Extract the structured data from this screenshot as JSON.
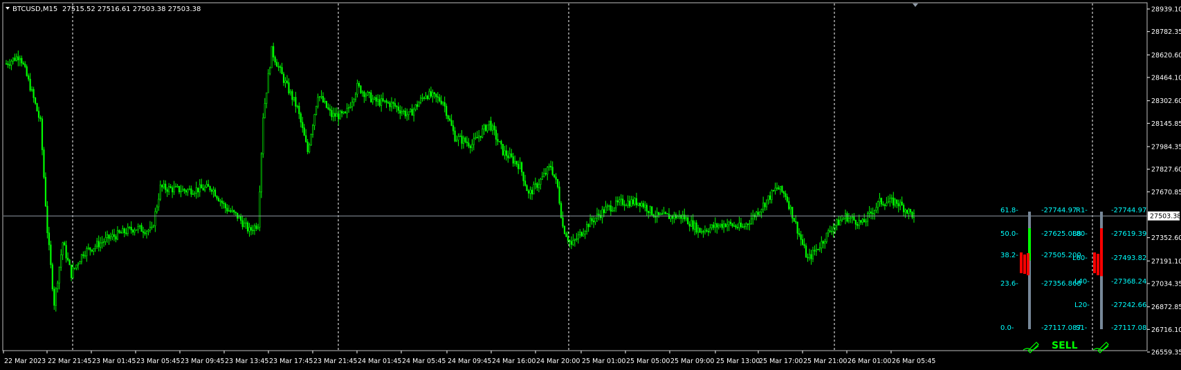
{
  "header": {
    "symbol": "BTCUSD,M15",
    "ohlc": "27515.52 27516.61 27503.38 27503.38"
  },
  "colors": {
    "background": "#000000",
    "candle": "#00ff00",
    "grid_separator": "#ffffff",
    "axis_text": "#ffffff",
    "price_line": "#8f9aa6",
    "fib_text": "#00ffff",
    "bar_up": "#00ff00",
    "bar_down": "#ff0000",
    "bar_track": "#778899",
    "sell_text": "#00ff00"
  },
  "price_axis": {
    "ticks": [
      "28939.10",
      "28782.35",
      "28620.60",
      "28464.10",
      "28302.60",
      "28145.85",
      "27984.35",
      "27827.60",
      "27670.85",
      "27352.60",
      "27191.10",
      "27034.35",
      "26872.85",
      "26716.10",
      "26559.35"
    ],
    "current_price": "27503.38",
    "range": [
      26559.35,
      28939.1
    ]
  },
  "time_axis": {
    "labels": [
      "22 Mar 2023",
      "22 Mar 21:45",
      "23 Mar 01:45",
      "23 Mar 05:45",
      "23 Mar 09:45",
      "23 Mar 13:45",
      "23 Mar 17:45",
      "23 Mar 21:45",
      "24 Mar 01:45",
      "24 Mar 05:45",
      "24 Mar 09:45",
      "24 Mar 16:00",
      "24 Mar 20:00",
      "25 Mar 01:00",
      "25 Mar 05:00",
      "25 Mar 09:00",
      "25 Mar 13:00",
      "25 Mar 17:00",
      "25 Mar 21:00",
      "26 Mar 01:00",
      "26 Mar 05:45"
    ]
  },
  "series_anchors": [
    {
      "i": 0,
      "p": 28560
    },
    {
      "i": 8,
      "p": 28620
    },
    {
      "i": 14,
      "p": 28400
    },
    {
      "i": 20,
      "p": 28150
    },
    {
      "i": 24,
      "p": 27400
    },
    {
      "i": 28,
      "p": 26900
    },
    {
      "i": 33,
      "p": 27320
    },
    {
      "i": 38,
      "p": 27100
    },
    {
      "i": 45,
      "p": 27250
    },
    {
      "i": 60,
      "p": 27350
    },
    {
      "i": 75,
      "p": 27420
    },
    {
      "i": 85,
      "p": 27400
    },
    {
      "i": 90,
      "p": 27700
    },
    {
      "i": 105,
      "p": 27680
    },
    {
      "i": 120,
      "p": 27700
    },
    {
      "i": 128,
      "p": 27560
    },
    {
      "i": 135,
      "p": 27500
    },
    {
      "i": 142,
      "p": 27400
    },
    {
      "i": 147,
      "p": 27450
    },
    {
      "i": 150,
      "p": 28200
    },
    {
      "i": 155,
      "p": 28650
    },
    {
      "i": 162,
      "p": 28450
    },
    {
      "i": 170,
      "p": 28250
    },
    {
      "i": 176,
      "p": 27950
    },
    {
      "i": 182,
      "p": 28350
    },
    {
      "i": 190,
      "p": 28200
    },
    {
      "i": 198,
      "p": 28200
    },
    {
      "i": 205,
      "p": 28400
    },
    {
      "i": 215,
      "p": 28300
    },
    {
      "i": 225,
      "p": 28280
    },
    {
      "i": 235,
      "p": 28200
    },
    {
      "i": 245,
      "p": 28350
    },
    {
      "i": 255,
      "p": 28300
    },
    {
      "i": 262,
      "p": 28050
    },
    {
      "i": 272,
      "p": 28000
    },
    {
      "i": 282,
      "p": 28150
    },
    {
      "i": 290,
      "p": 27950
    },
    {
      "i": 300,
      "p": 27850
    },
    {
      "i": 305,
      "p": 27650
    },
    {
      "i": 312,
      "p": 27750
    },
    {
      "i": 318,
      "p": 27850
    },
    {
      "i": 322,
      "p": 27700
    },
    {
      "i": 325,
      "p": 27430
    },
    {
      "i": 330,
      "p": 27300
    },
    {
      "i": 340,
      "p": 27450
    },
    {
      "i": 350,
      "p": 27550
    },
    {
      "i": 360,
      "p": 27600
    },
    {
      "i": 370,
      "p": 27600
    },
    {
      "i": 380,
      "p": 27500
    },
    {
      "i": 395,
      "p": 27500
    },
    {
      "i": 405,
      "p": 27400
    },
    {
      "i": 420,
      "p": 27450
    },
    {
      "i": 430,
      "p": 27420
    },
    {
      "i": 440,
      "p": 27550
    },
    {
      "i": 450,
      "p": 27700
    },
    {
      "i": 455,
      "p": 27650
    },
    {
      "i": 460,
      "p": 27480
    },
    {
      "i": 468,
      "p": 27200
    },
    {
      "i": 475,
      "p": 27300
    },
    {
      "i": 482,
      "p": 27420
    },
    {
      "i": 490,
      "p": 27500
    },
    {
      "i": 500,
      "p": 27450
    },
    {
      "i": 510,
      "p": 27600
    },
    {
      "i": 520,
      "p": 27600
    },
    {
      "i": 530,
      "p": 27503
    }
  ],
  "fib_panel": {
    "levels": [
      {
        "label": "61.8-",
        "value": "-27744.97"
      },
      {
        "label": "50.0-",
        "value": "-27625.088"
      },
      {
        "label": "38.2-",
        "value": "-27505.200"
      },
      {
        "label": "23.6-",
        "value": "-27356.868"
      },
      {
        "label": "0.0-",
        "value": "-27117.087"
      }
    ],
    "bar_up_fraction": 0.55,
    "bar_down_fraction": 0.12
  },
  "pivot_panel": {
    "levels": [
      {
        "label": "R1-",
        "value": "-27744.97"
      },
      {
        "label": "L80-",
        "value": "-27619.39"
      },
      {
        "label": "L60-",
        "value": "-27493.82"
      },
      {
        "label": "L40-",
        "value": "-27368.24"
      },
      {
        "label": "L20-",
        "value": "-27242.66"
      },
      {
        "label": "S1-",
        "value": "-27117.08"
      }
    ],
    "bar_down_fraction": 0.48
  },
  "signal": {
    "label": "SELL",
    "icon_left": "pen-signature-icon",
    "icon_right": "pen-signature-icon"
  }
}
